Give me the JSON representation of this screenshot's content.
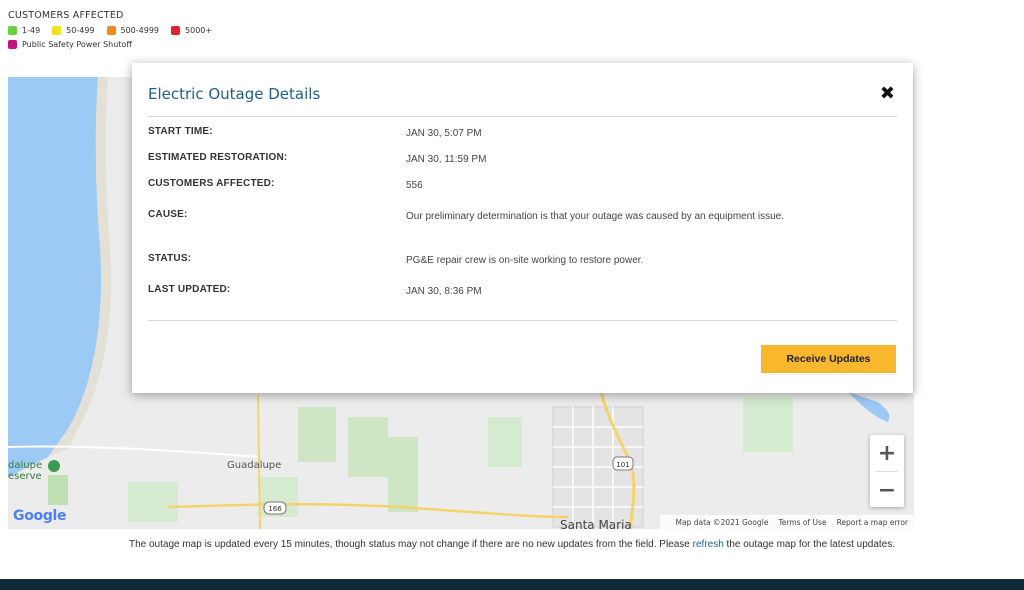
{
  "legend": {
    "title": "CUSTOMERS AFFECTED",
    "items": [
      {
        "label": "1-49",
        "color": "#6ccf3f"
      },
      {
        "label": "50-499",
        "color": "#f2e21a"
      },
      {
        "label": "500-4999",
        "color": "#f28a1a"
      },
      {
        "label": "5000+",
        "color": "#e4202a"
      }
    ],
    "psps": {
      "label": "Public Safety Power Shutoff",
      "color": "#c4127f"
    }
  },
  "map": {
    "labels": {
      "guadalupe": "Guadalupe",
      "santa_maria": "Santa Maria",
      "reserve_line1": "dalupe",
      "reserve_line2": "eserve"
    },
    "route_shields": [
      "166",
      "101"
    ],
    "logo": "Google",
    "attribution": {
      "map_data": "Map data ©2021 Google",
      "terms": "Terms of Use",
      "report": "Report a map error"
    },
    "zoom_in": "+",
    "zoom_out": "−"
  },
  "modal": {
    "title": "Electric Outage Details",
    "close": "✖",
    "rows": [
      {
        "label": "START TIME:",
        "value": "JAN 30, 5:07 PM"
      },
      {
        "label": "ESTIMATED RESTORATION:",
        "value": "JAN 30, 11:59 PM"
      },
      {
        "label": "CUSTOMERS AFFECTED:",
        "value": "556"
      },
      {
        "label": "CAUSE:",
        "value": "Our preliminary determination is that your outage was caused by an equipment issue."
      },
      {
        "label": "STATUS:",
        "value": "PG&E repair crew is on-site working to restore power."
      },
      {
        "label": "LAST UPDATED:",
        "value": "JAN 30, 8:36 PM"
      }
    ],
    "receive_button": "Receive Updates"
  },
  "footer": {
    "note_before": "The outage map is updated every 15 minutes, though status may not change if there are no new updates from the field. Please ",
    "link": "refresh",
    "note_after": " the outage map for the latest updates."
  }
}
